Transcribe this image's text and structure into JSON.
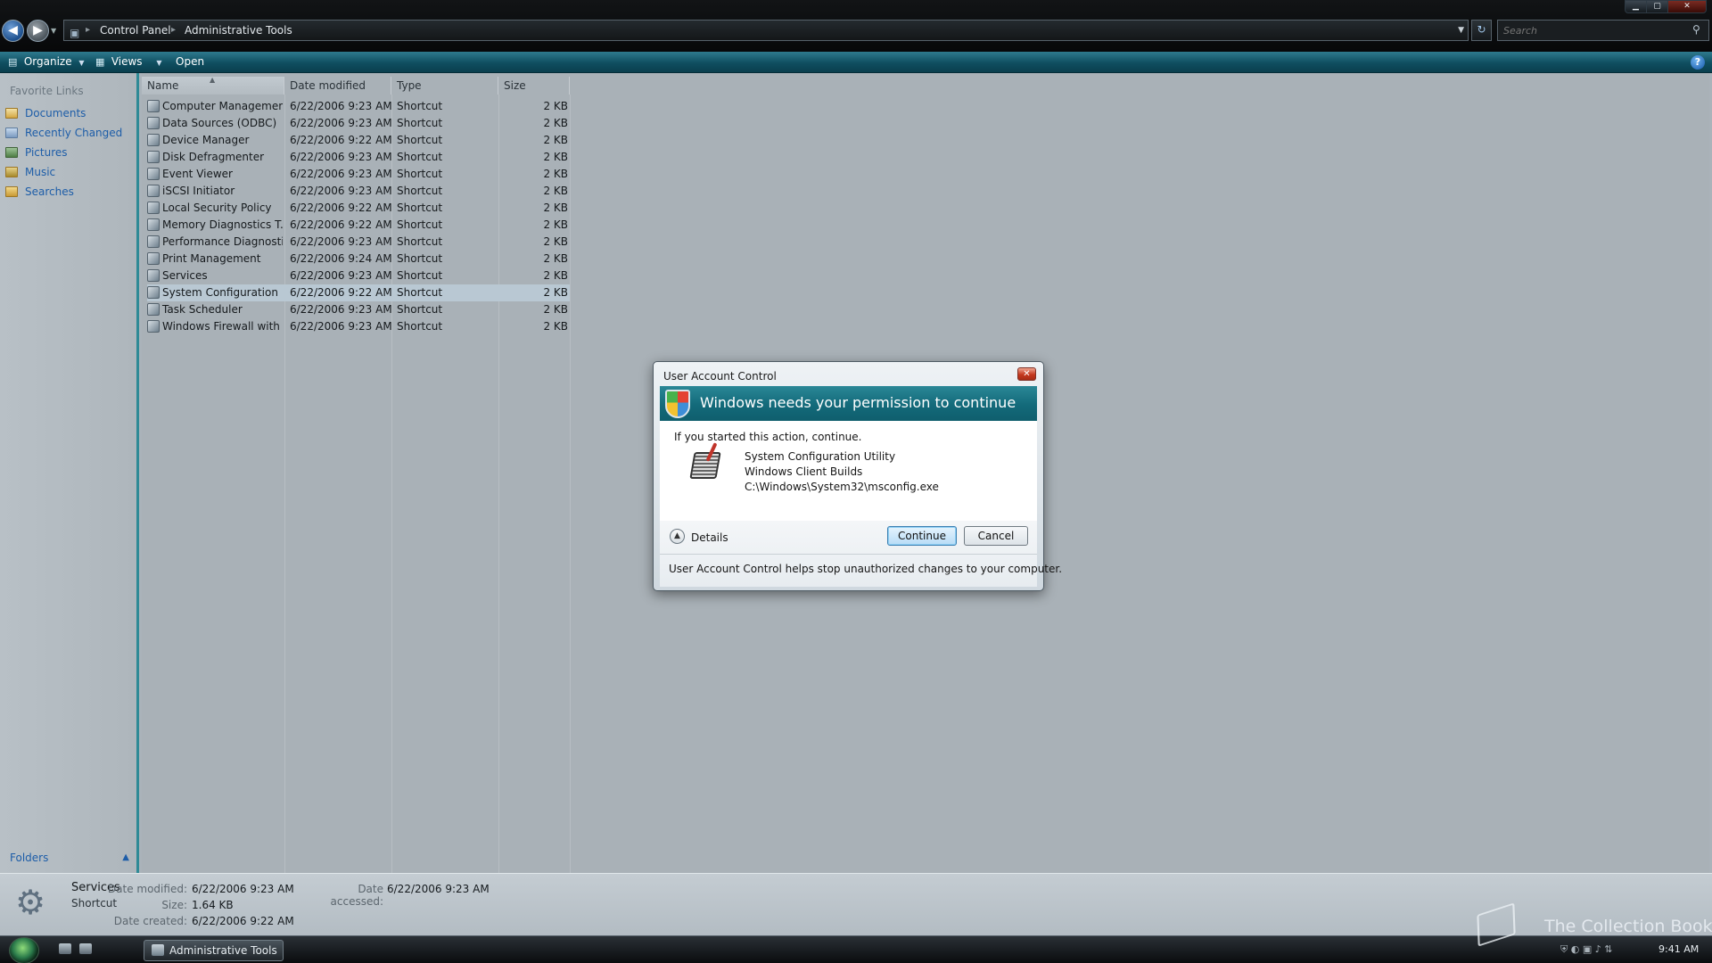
{
  "window": {
    "breadcrumbs": [
      "Control Panel",
      "Administrative Tools"
    ],
    "search_placeholder": "Search"
  },
  "toolbar": {
    "organize_label": "Organize",
    "views_label": "Views",
    "open_label": "Open",
    "help_label": "?"
  },
  "navpane": {
    "header": "Favorite Links",
    "links": [
      "Documents",
      "Recently Changed",
      "Pictures",
      "Music",
      "Searches"
    ],
    "folders_label": "Folders"
  },
  "filelist": {
    "columns": [
      "Name",
      "Date modified",
      "Type",
      "Size"
    ],
    "selected_row": "System Configuration",
    "rows": [
      {
        "name": "Computer Management",
        "date": "6/22/2006 9:23 AM",
        "type": "Shortcut",
        "size": "2 KB"
      },
      {
        "name": "Data Sources (ODBC)",
        "date": "6/22/2006 9:23 AM",
        "type": "Shortcut",
        "size": "2 KB"
      },
      {
        "name": "Device Manager",
        "date": "6/22/2006 9:22 AM",
        "type": "Shortcut",
        "size": "2 KB"
      },
      {
        "name": "Disk Defragmenter",
        "date": "6/22/2006 9:23 AM",
        "type": "Shortcut",
        "size": "2 KB"
      },
      {
        "name": "Event Viewer",
        "date": "6/22/2006 9:23 AM",
        "type": "Shortcut",
        "size": "2 KB"
      },
      {
        "name": "iSCSI Initiator",
        "date": "6/22/2006 9:23 AM",
        "type": "Shortcut",
        "size": "2 KB"
      },
      {
        "name": "Local Security Policy",
        "date": "6/22/2006 9:22 AM",
        "type": "Shortcut",
        "size": "2 KB"
      },
      {
        "name": "Memory Diagnostics T...",
        "date": "6/22/2006 9:22 AM",
        "type": "Shortcut",
        "size": "2 KB"
      },
      {
        "name": "Performance Diagnosti...",
        "date": "6/22/2006 9:23 AM",
        "type": "Shortcut",
        "size": "2 KB"
      },
      {
        "name": "Print Management",
        "date": "6/22/2006 9:24 AM",
        "type": "Shortcut",
        "size": "2 KB"
      },
      {
        "name": "Services",
        "date": "6/22/2006 9:23 AM",
        "type": "Shortcut",
        "size": "2 KB"
      },
      {
        "name": "System Configuration",
        "date": "6/22/2006 9:22 AM",
        "type": "Shortcut",
        "size": "2 KB"
      },
      {
        "name": "Task Scheduler",
        "date": "6/22/2006 9:23 AM",
        "type": "Shortcut",
        "size": "2 KB"
      },
      {
        "name": "Windows Firewall with ...",
        "date": "6/22/2006 9:23 AM",
        "type": "Shortcut",
        "size": "2 KB"
      }
    ]
  },
  "details": {
    "name": "Services",
    "kind": "Shortcut",
    "date_modified_label": "Date modified:",
    "date_modified": "6/22/2006 9:23 AM",
    "size_label": "Size:",
    "size": "1.64 KB",
    "date_created_label": "Date created:",
    "date_created": "6/22/2006 9:22 AM",
    "date_accessed_label": "Date accessed:",
    "date_accessed": "6/22/2006 9:23 AM"
  },
  "uac": {
    "title": "User Account Control",
    "banner": "Windows needs your permission to continue",
    "instruction": "If you started this action, continue.",
    "program_name": "System Configuration Utility",
    "publisher": "Windows Client Builds",
    "path": "C:\\Windows\\System32\\msconfig.exe",
    "details_label": "Details",
    "continue_label": "Continue",
    "cancel_label": "Cancel",
    "info": "User Account Control helps stop unauthorized changes to your computer."
  },
  "taskbar": {
    "task_button": "Administrative Tools",
    "clock": "9:41 AM"
  },
  "watermark": "The Collection Book",
  "colors": {
    "accent_teal": "#136a7a",
    "link_blue": "#1d5da8",
    "selection": "#b9c8d3"
  }
}
